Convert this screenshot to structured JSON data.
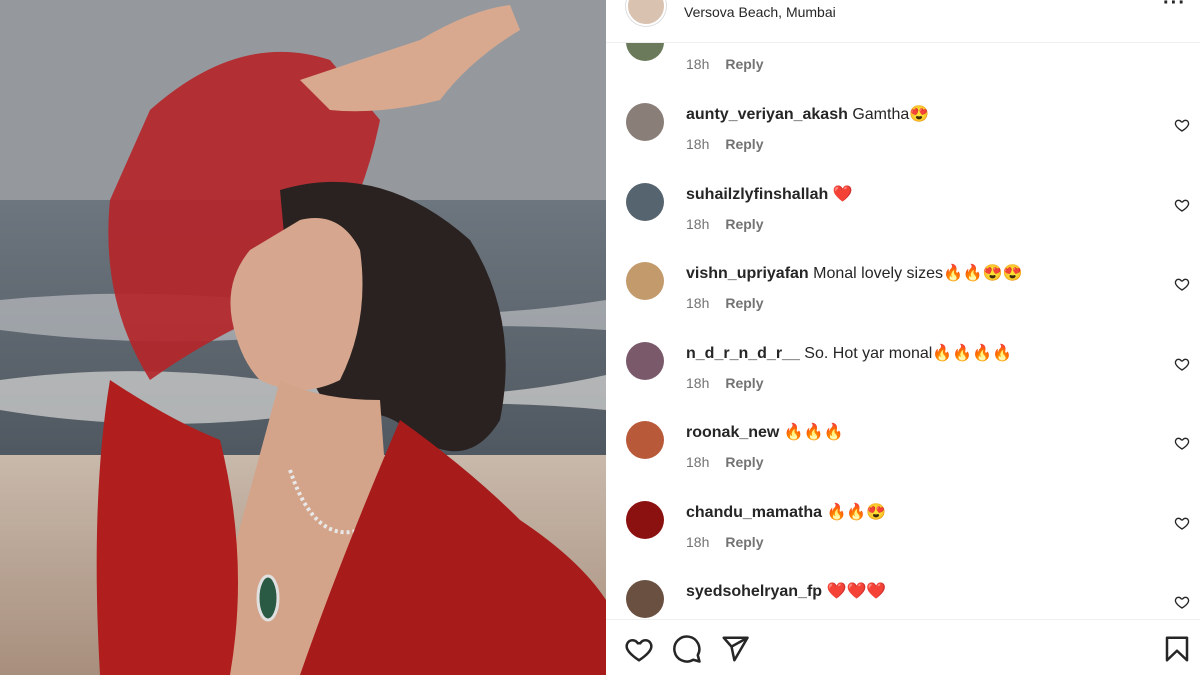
{
  "header": {
    "location": "Versova Beach, Mumbai",
    "more_icon": "more-horizontal-icon"
  },
  "comments": [
    {
      "username": "",
      "text": "",
      "time": "18h",
      "reply": "Reply",
      "avatar_color": "#6b7a5a"
    },
    {
      "username": "aunty_veriyan_akash",
      "text": "Gamtha😍",
      "time": "18h",
      "reply": "Reply",
      "avatar_color": "#8a7f78"
    },
    {
      "username": "suhailzlyfinshallah",
      "text": "❤️",
      "time": "18h",
      "reply": "Reply",
      "avatar_color": "#56646f"
    },
    {
      "username": "vishn_upriyafan",
      "text": "Monal lovely sizes🔥🔥😍😍",
      "time": "18h",
      "reply": "Reply",
      "avatar_color": "#c29a6c"
    },
    {
      "username": "n_d_r_n_d_r__",
      "text": "So. Hot yar monal🔥🔥🔥🔥",
      "time": "18h",
      "reply": "Reply",
      "avatar_color": "#7a5a6a"
    },
    {
      "username": "roonak_new",
      "text": "🔥🔥🔥",
      "time": "18h",
      "reply": "Reply",
      "avatar_color": "#b85a3a"
    },
    {
      "username": "chandu_mamatha",
      "text": "🔥🔥😍",
      "time": "18h",
      "reply": "Reply",
      "avatar_color": "#8b1010"
    },
    {
      "username": "syedsohelryan_fp",
      "text": "❤️❤️❤️",
      "time": "",
      "reply": "",
      "avatar_color": "#6a5040"
    }
  ],
  "actions": {
    "like_icon": "heart-icon",
    "comment_icon": "comment-icon",
    "share_icon": "send-icon",
    "save_icon": "bookmark-icon"
  },
  "colors": {
    "text": "#262626",
    "meta": "#737373",
    "divider": "#efefef",
    "dress_red": "#b01e1e"
  }
}
